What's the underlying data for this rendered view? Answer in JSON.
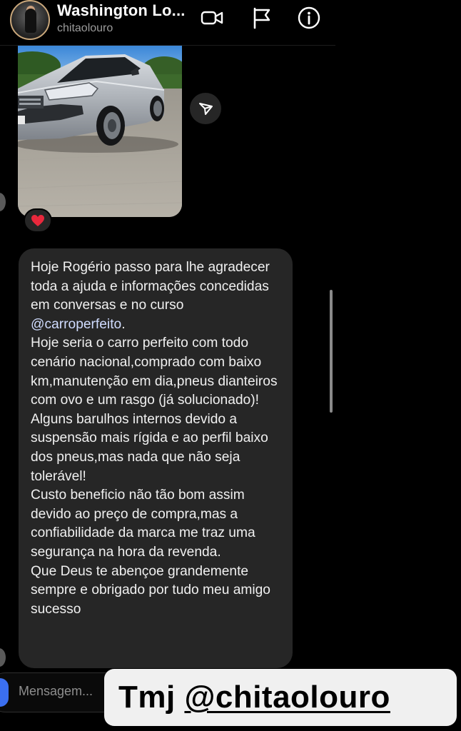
{
  "header": {
    "title": "Washington Lo...",
    "username": "chitaolouro",
    "icons": [
      "video-call-icon",
      "flag-icon",
      "info-icon"
    ]
  },
  "image_message": {
    "reaction": "❤️"
  },
  "text_message": {
    "before_mention": "Hoje Rogério passo para lhe agradecer toda a ajuda e informações concedidas em conversas e no curso ",
    "mention": "@carroperfeito",
    "after_mention": ".\nHoje seria o carro perfeito com todo cenário nacional,comprado com baixo km,manutenção em dia,pneus dianteiros com ovo e um rasgo (já solucionado)!\nAlguns barulhos internos devido a suspensão mais rígida e ao perfil baixo dos pneus,mas nada que não seja tolerável!\nCusto beneficio não tão bom assim devido ao preço de compra,mas a confiabilidade da marca me traz uma segurança na hora da revenda.\nQue Deus te abençoe grandemente sempre e obrigado por tudo meu amigo sucesso"
  },
  "composer": {
    "placeholder": "Mensagem..."
  },
  "caption": {
    "prefix": "Tmj ",
    "handle": "@chitaolouro"
  },
  "colors": {
    "background": "#000000",
    "bubble": "#262626",
    "mention": "#d0dcff",
    "caption_bg": "#f0f0f0"
  }
}
